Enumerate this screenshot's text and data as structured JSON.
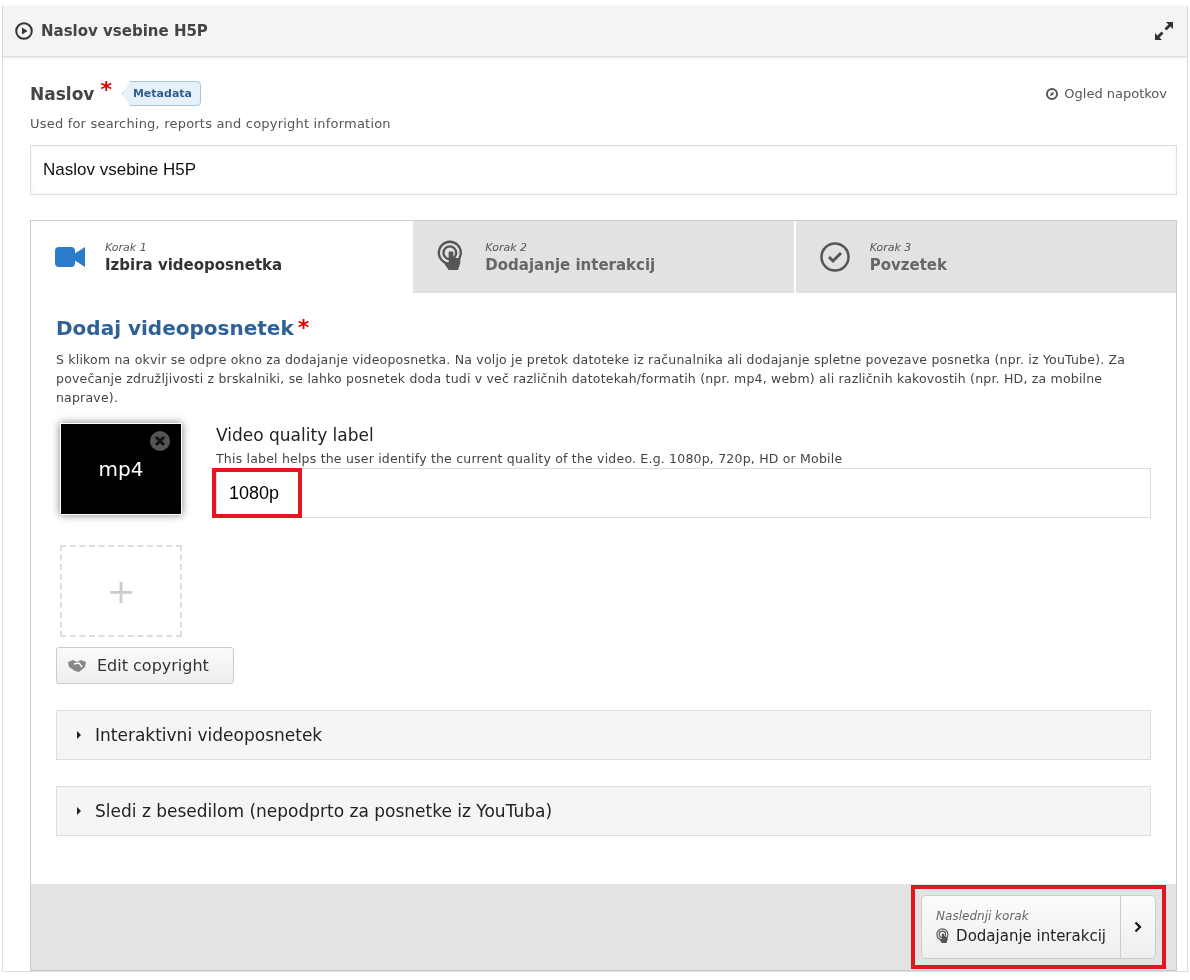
{
  "header": {
    "title": "Naslov vsebine H5P"
  },
  "title_field": {
    "label": "Naslov",
    "required_mark": "*",
    "metadata_button": "Metadata",
    "tutorial_link": "Ogled napotkov",
    "description": "Used for searching, reports and copyright information",
    "value": "Naslov vsebine H5P"
  },
  "steps": [
    {
      "kind": "video",
      "step_label": "Korak 1",
      "title": "Izbira videoposnetka",
      "selected": true
    },
    {
      "kind": "touch",
      "step_label": "Korak 2",
      "title": "Dodajanje interakcij",
      "selected": false
    },
    {
      "kind": "check",
      "step_label": "Korak 3",
      "title": "Povzetek",
      "selected": false
    }
  ],
  "video_section": {
    "title": "Dodaj videoposnetek",
    "required_mark": "*",
    "description": "S klikom na okvir se odpre okno za dodajanje videoposnetka. Na voljo je pretok datoteke iz računalnika ali dodajanje spletne povezave posnetka (npr. iz YouTube). Za povečanje združljivosti z brskalniki, se lahko posnetek doda tudi v več različnih datotekah/formatih (npr. mp4, webm) ali različnih kakovostih (npr. HD, za mobilne naprave).",
    "file_label": "mp4",
    "quality_label": "Video quality label",
    "quality_description": "This label helps the user identify the current quality of the video. E.g. 1080p, 720p, HD or Mobile",
    "quality_value": "1080p",
    "quality_highlighted": true,
    "add_symbol": "+",
    "copyright_button": "Edit copyright"
  },
  "accordions": [
    {
      "label": "Interaktivni videoposnetek",
      "expanded": false
    },
    {
      "label": "Sledi z besedilom (nepodprto za posnetke iz YouTuba)",
      "expanded": false
    }
  ],
  "next_step": {
    "label": "Naslednji korak",
    "title": "Dodajanje interakcij",
    "highlighted": true
  }
}
